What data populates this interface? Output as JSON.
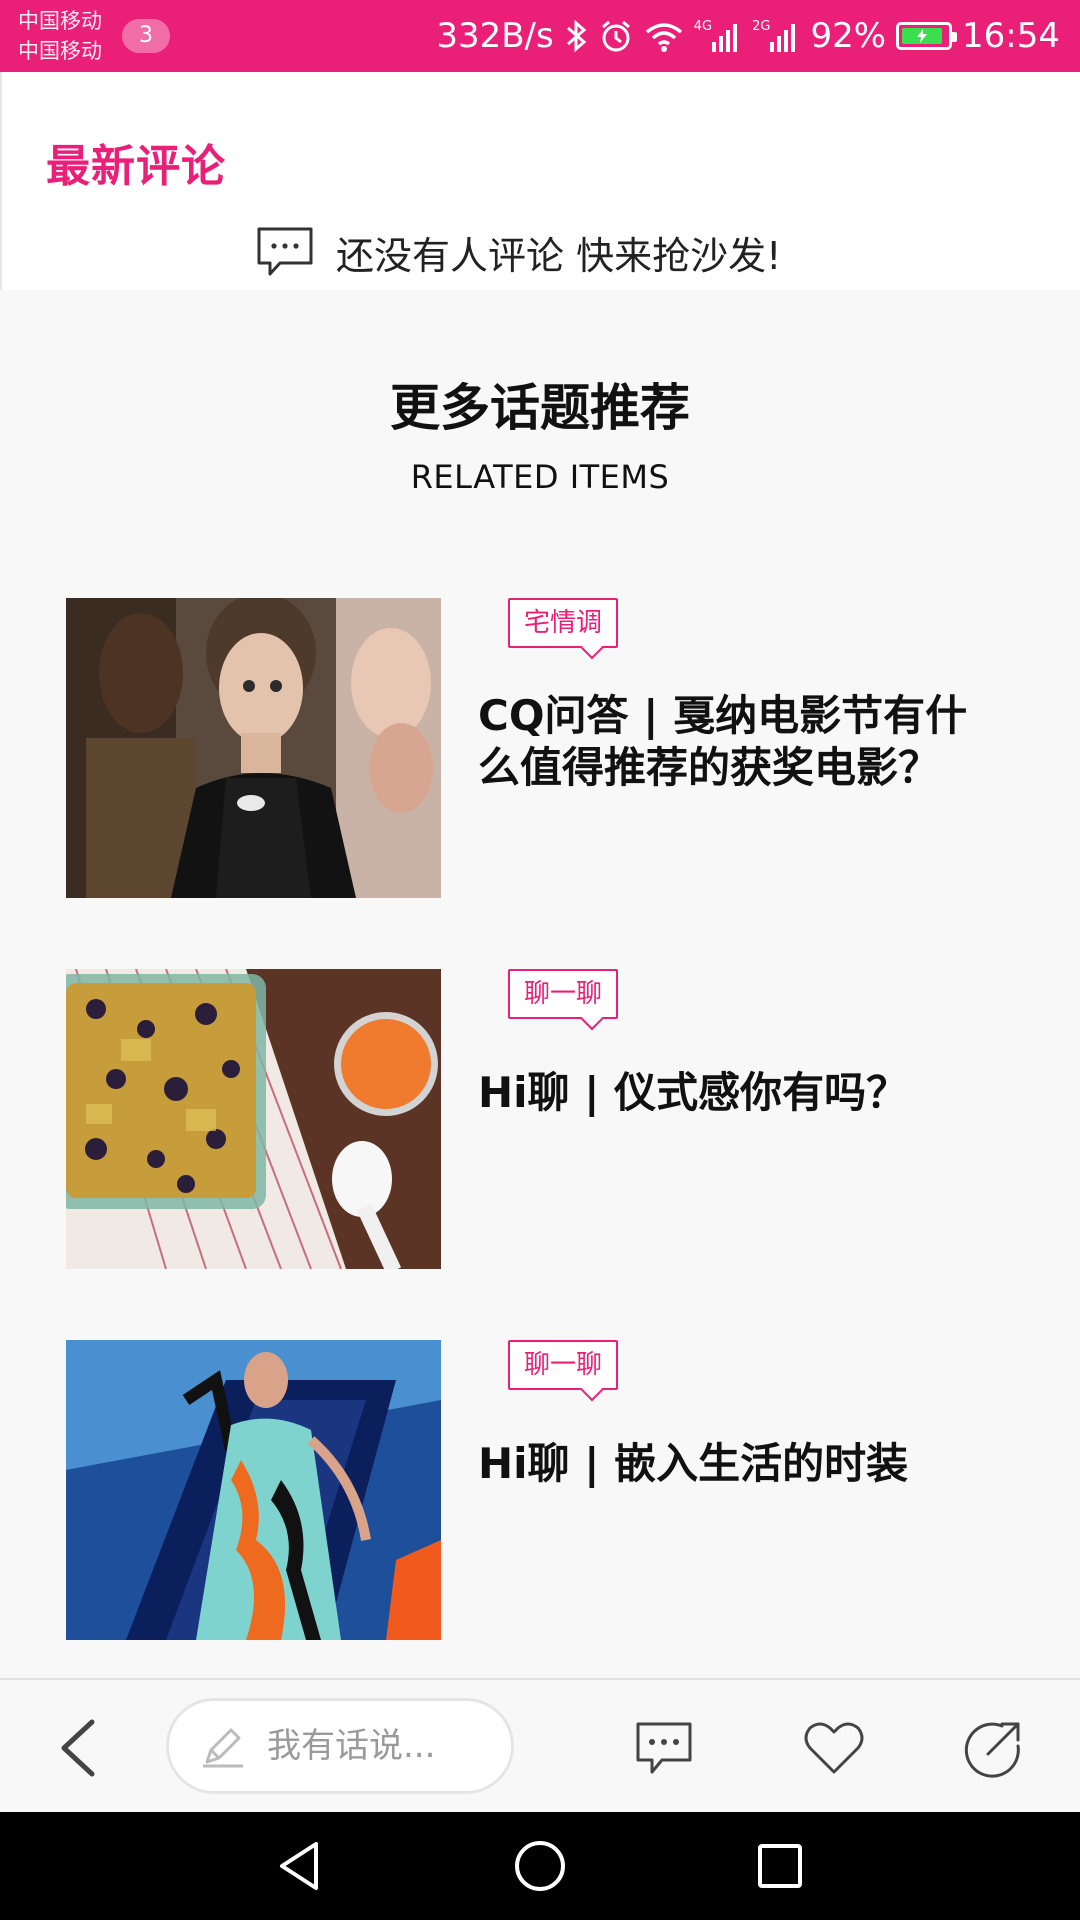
{
  "status_bar": {
    "carrier_1": "中国移动",
    "carrier_2": "中国移动",
    "notification_count": "3",
    "net_speed": "332B/s",
    "net_4g": "4G",
    "net_2g": "2G",
    "battery": "92%",
    "time": "16:54"
  },
  "comments": {
    "title": "最新评论",
    "empty_text": "还没有人评论 快来抢沙发!"
  },
  "related": {
    "title": "更多话题推荐",
    "subtitle": "RELATED ITEMS",
    "items": [
      {
        "tag": "宅情调",
        "title": "CQ问答 | 戛纳电影节有什么值得推荐的获奖电影？",
        "image": "woman-red-carpet"
      },
      {
        "tag": "聊一聊",
        "title": "Hi聊 | 仪式感你有吗？",
        "image": "bread-pudding-juice"
      },
      {
        "tag": "聊一聊",
        "title": "Hi聊 | 嵌入生活的时装",
        "image": "fashion-model-dress"
      }
    ]
  },
  "bottom_bar": {
    "comment_placeholder": "我有话说..."
  },
  "colors": {
    "accent": "#ea1f78",
    "background": "#f8f8f8",
    "nav_background": "#000000"
  }
}
